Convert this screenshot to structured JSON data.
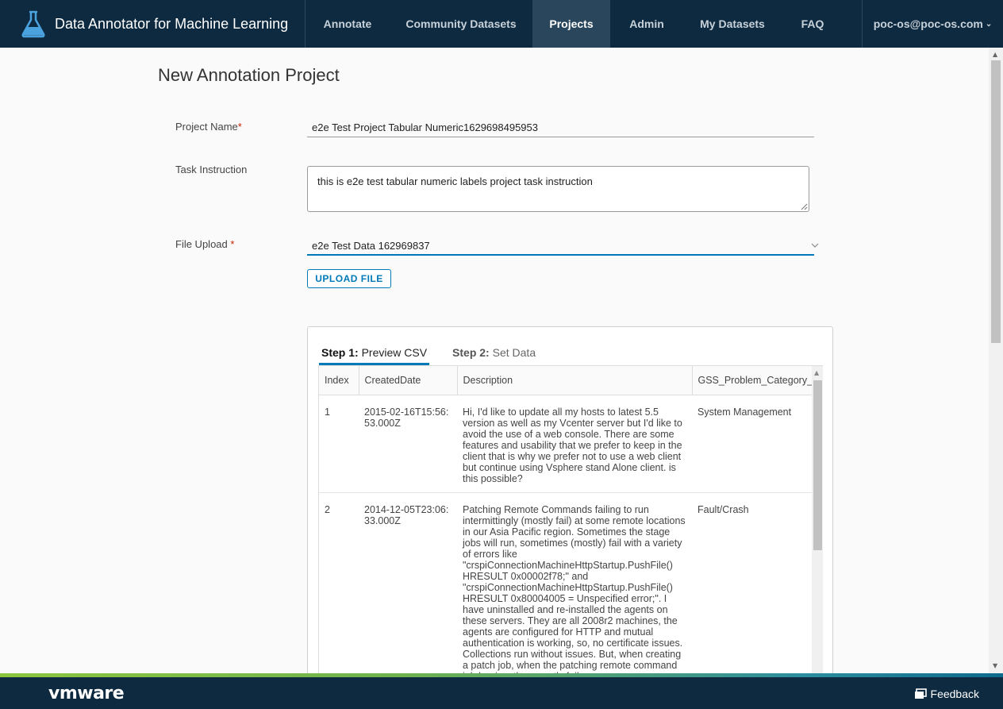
{
  "header": {
    "app_title": "Data Annotator for Machine Learning",
    "nav": [
      {
        "label": "Annotate",
        "active": false
      },
      {
        "label": "Community Datasets",
        "active": false
      },
      {
        "label": "Projects",
        "active": true
      },
      {
        "label": "Admin",
        "active": false
      },
      {
        "label": "My Datasets",
        "active": false
      },
      {
        "label": "FAQ",
        "active": false
      }
    ],
    "user": "poc-os@poc-os.com"
  },
  "form": {
    "page_title": "New Annotation Project",
    "project_name_label": "Project Name",
    "project_name_value": "e2e Test Project Tabular Numeric1629698495953",
    "task_instruction_label": "Task Instruction",
    "task_instruction_value": "this is e2e test tabular numeric labels project task instruction",
    "file_upload_label": "File Upload ",
    "file_upload_value": "e2e Test Data 162969837",
    "required_mark": "*",
    "upload_button": "UPLOAD FILE"
  },
  "wizard": {
    "tabs": [
      {
        "step": "Step 1:",
        "label": " Preview CSV",
        "active": true
      },
      {
        "step": "Step 2:",
        "label": " Set Data",
        "active": false
      }
    ],
    "columns": [
      "Index",
      "CreatedDate",
      "Description",
      "GSS_Problem_Category_"
    ],
    "rows": [
      {
        "index": "1",
        "created": "2015-02-16T15:56:53.000Z",
        "description": "Hi, I'd like to update all my hosts to latest 5.5 version as well as my Vcenter server but I'd like to avoid the use of a web console. There are some features and usability that we prefer to keep in the client that is why we prefer not to use a web client but continue using Vsphere stand Alone client. is this possible?",
        "category": "System Management"
      },
      {
        "index": "2",
        "created": "2014-12-05T23:06:33.000Z",
        "description": "Patching Remote Commands failing to run intermittingly (mostly fail) at some remote locations in our Asia Pacific region. Sometimes the stage jobs will run, sometimes (mostly) fail with a variety of errors like \"crspiConnectionMachineHttpStartup.PushFile() HRESULT 0x00002f78;\" and \"crspiConnectionMachineHttpStartup.PushFile() HRESULT 0x80004005 = Unspecified error;\". I have uninstalled and re-installed the agents on these servers. They are all 2008r2 machines, the agents are configured for HTTP and mutual authentication is working, so, no certificate issues. Collections run without issues. But, when creating a patch job, when the patching remote command job begins, they mostly fail.",
        "category": "Fault/Crash"
      }
    ]
  },
  "footer": {
    "logo": "vmware",
    "feedback": "Feedback"
  }
}
